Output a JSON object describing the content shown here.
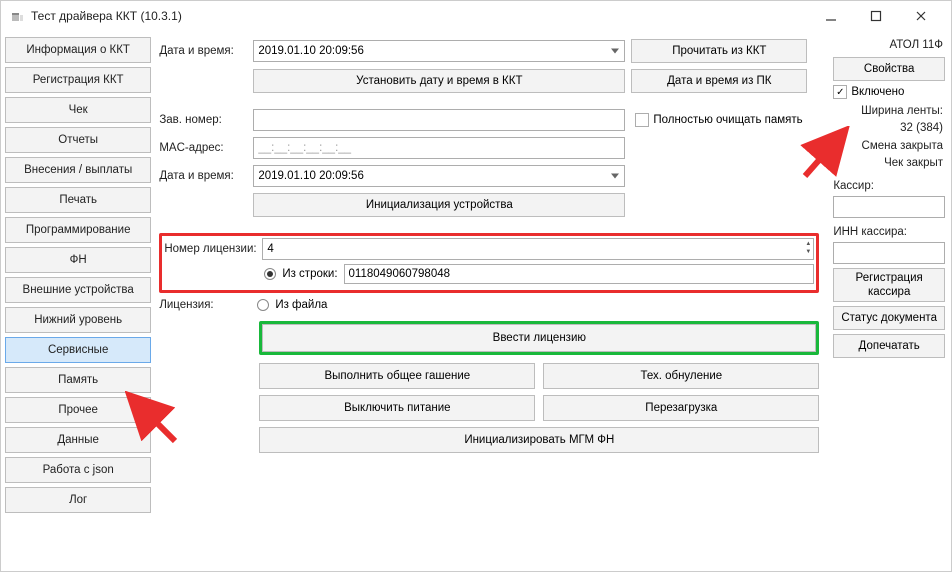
{
  "window": {
    "title": "Тест драйвера ККТ (10.3.1)"
  },
  "sidebar": {
    "items": [
      "Информация о ККТ",
      "Регистрация ККТ",
      "Чек",
      "Отчеты",
      "Внесения / выплаты",
      "Печать",
      "Программирование",
      "ФН",
      "Внешние устройства",
      "Нижний уровень",
      "Сервисные",
      "Память",
      "Прочее",
      "Данные",
      "Работа с json",
      "Лог"
    ],
    "selected_index": 10
  },
  "main": {
    "datetime_label": "Дата и время:",
    "datetime_value": "2019.01.10 20:09:56",
    "read_from_kkt": "Прочитать из ККТ",
    "set_datetime": "Установить дату и время в ККТ",
    "datetime_from_pc": "Дата и время из ПК",
    "serial_label": "Зав. номер:",
    "serial_value": "",
    "full_clear_memory": "Полностью очищать память",
    "mac_label": "MAC-адрес:",
    "mac_value": "__:__:__:__:__:__",
    "datetime2_label": "Дата и время:",
    "datetime2_value": "2019.01.10 20:09:56",
    "init_device": "Инициализация устройства",
    "license_num_label": "Номер лицензии:",
    "license_num_value": "4",
    "license_label": "Лицензия:",
    "from_string_label": "Из строки:",
    "from_string_value": "0118049060798048",
    "from_file_label": "Из файла",
    "enter_license": "Ввести лицензию",
    "general_erase": "Выполнить общее гашение",
    "tech_reset": "Тех. обнуление",
    "power_off": "Выключить питание",
    "reboot": "Перезагрузка",
    "init_mgm_fn": "Инициализировать МГМ ФН"
  },
  "right": {
    "device_name": "АТОЛ 11Ф",
    "properties": "Свойства",
    "enabled_label": "Включено",
    "enabled_checked": true,
    "tape_width_label": "Ширина ленты:",
    "tape_width_value": "32 (384)",
    "shift_closed": "Смена закрыта",
    "check_closed": "Чек закрыт",
    "cashier_label": "Кассир:",
    "cashier_value": "",
    "cashier_inn_label": "ИНН кассира:",
    "cashier_inn_value": "",
    "register_cashier": "Регистрация кассира",
    "doc_status": "Статус документа",
    "finish_print": "Допечатать"
  }
}
